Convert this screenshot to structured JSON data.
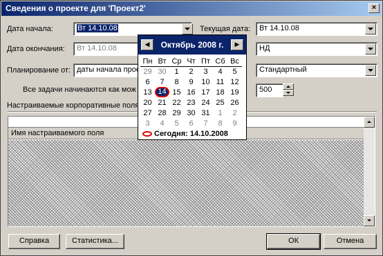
{
  "window": {
    "title": "Сведения о проекте для 'Проект2'",
    "close_glyph": "×"
  },
  "fields": {
    "start_date": {
      "label": "Дата начала:",
      "value": "Вт 14.10.08"
    },
    "finish_date": {
      "label": "Дата окончания:",
      "value": "Вт 14.10.08"
    },
    "schedule_from": {
      "label": "Планирование от:",
      "value": "даты начала прое"
    },
    "all_tasks_note": "Все задачи начинаются как мож",
    "current_date": {
      "label": "Текущая дата:",
      "value": "Вт 14.10.08"
    },
    "status_date": {
      "value": "НД"
    },
    "calendar": {
      "value": "Стандартный"
    },
    "priority": {
      "value": "500"
    }
  },
  "custom_fields": {
    "group_label": "Настраиваемые корпоративные поля",
    "column_header": "Имя настраиваемого поля"
  },
  "buttons": {
    "help": "Справка",
    "statistics": "Статистика...",
    "ok": "ОК",
    "cancel": "Отмена"
  },
  "calendar_popup": {
    "month_label": "Октябрь 2008 г.",
    "prev_glyph": "◀",
    "next_glyph": "▶",
    "weekdays": [
      "Пн",
      "Вт",
      "Ср",
      "Чт",
      "Пт",
      "Сб",
      "Вс"
    ],
    "weeks": [
      [
        {
          "d": "29",
          "o": true
        },
        {
          "d": "30",
          "o": true
        },
        {
          "d": "1"
        },
        {
          "d": "2"
        },
        {
          "d": "3"
        },
        {
          "d": "4"
        },
        {
          "d": "5"
        }
      ],
      [
        {
          "d": "6"
        },
        {
          "d": "7"
        },
        {
          "d": "8"
        },
        {
          "d": "9"
        },
        {
          "d": "10"
        },
        {
          "d": "11"
        },
        {
          "d": "12"
        }
      ],
      [
        {
          "d": "13"
        },
        {
          "d": "14",
          "t": true
        },
        {
          "d": "15"
        },
        {
          "d": "16"
        },
        {
          "d": "17"
        },
        {
          "d": "18"
        },
        {
          "d": "19"
        }
      ],
      [
        {
          "d": "20"
        },
        {
          "d": "21"
        },
        {
          "d": "22"
        },
        {
          "d": "23"
        },
        {
          "d": "24"
        },
        {
          "d": "25"
        },
        {
          "d": "26"
        }
      ],
      [
        {
          "d": "27"
        },
        {
          "d": "28"
        },
        {
          "d": "29"
        },
        {
          "d": "30"
        },
        {
          "d": "31"
        },
        {
          "d": "1",
          "o": true
        },
        {
          "d": "2",
          "o": true
        }
      ],
      [
        {
          "d": "3",
          "o": true
        },
        {
          "d": "4",
          "o": true
        },
        {
          "d": "5",
          "o": true
        },
        {
          "d": "6",
          "o": true
        },
        {
          "d": "7",
          "o": true
        },
        {
          "d": "8",
          "o": true
        },
        {
          "d": "9",
          "o": true
        }
      ]
    ],
    "today_label": "Сегодня: 14.10.2008"
  }
}
